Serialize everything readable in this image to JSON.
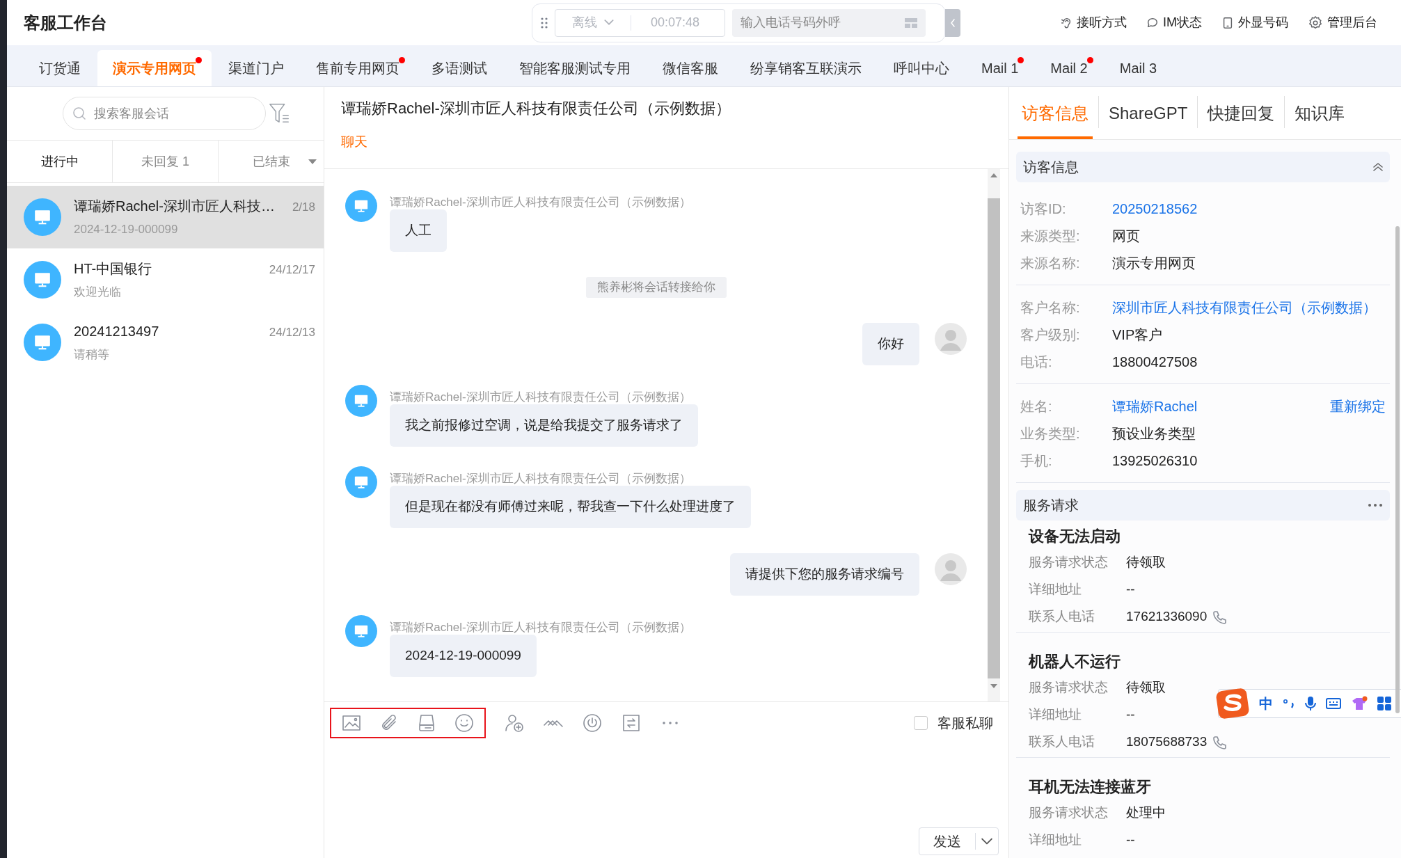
{
  "header": {
    "title": "客服工作台",
    "status": "离线",
    "timer": "00:07:48",
    "dial_placeholder": "输入电话号码外呼",
    "actions": [
      {
        "kind": "ear",
        "label": "接听方式"
      },
      {
        "kind": "chat",
        "label": "IM状态"
      },
      {
        "kind": "phone",
        "label": "外显号码"
      },
      {
        "kind": "gear",
        "label": "管理后台"
      }
    ]
  },
  "tabs": [
    {
      "label": "订货通",
      "selected": false,
      "dot": false
    },
    {
      "label": "演示专用网页",
      "selected": true,
      "dot": true
    },
    {
      "label": "渠道门户",
      "selected": false,
      "dot": false
    },
    {
      "label": "售前专用网页",
      "selected": false,
      "dot": true
    },
    {
      "label": "多语测试",
      "selected": false,
      "dot": false
    },
    {
      "label": "智能客服测试专用",
      "selected": false,
      "dot": false
    },
    {
      "label": "微信客服",
      "selected": false,
      "dot": false
    },
    {
      "label": "纷享销客互联演示",
      "selected": false,
      "dot": false
    },
    {
      "label": "呼叫中心",
      "selected": false,
      "dot": false
    },
    {
      "label": "Mail 1",
      "selected": false,
      "dot": true
    },
    {
      "label": "Mail 2",
      "selected": false,
      "dot": true
    },
    {
      "label": "Mail 3",
      "selected": false,
      "dot": false
    }
  ],
  "sidebar": {
    "search_placeholder": "搜索客服会话",
    "filters": [
      {
        "label": "进行中",
        "selected": true
      },
      {
        "label": "未回复 1",
        "selected": false
      },
      {
        "label": "已结束",
        "selected": false
      }
    ],
    "sessions": [
      {
        "name": "谭瑞娇Rachel-深圳市匠人科技…",
        "time": "2/18",
        "preview": "2024-12-19-000099",
        "selected": true
      },
      {
        "name": "HT-中国银行",
        "time": "24/12/17",
        "preview": "欢迎光临",
        "selected": false
      },
      {
        "name": "20241213497",
        "time": "24/12/13",
        "preview": "请稍等",
        "selected": false
      }
    ]
  },
  "chat": {
    "title": "谭瑞娇Rachel-深圳市匠人科技有限责任公司（示例数据）",
    "subtab": "聊天",
    "messages": [
      {
        "kind": "visitor",
        "sender": "谭瑞娇Rachel-深圳市匠人科技有限责任公司（示例数据）",
        "text": "人工"
      },
      {
        "kind": "system",
        "text": "熊养彬将会话转接给你"
      },
      {
        "kind": "agent",
        "text": "你好"
      },
      {
        "kind": "visitor",
        "sender": "谭瑞娇Rachel-深圳市匠人科技有限责任公司（示例数据）",
        "text": "我之前报修过空调，说是给我提交了服务请求了"
      },
      {
        "kind": "visitor",
        "sender": "谭瑞娇Rachel-深圳市匠人科技有限责任公司（示例数据）",
        "text": "但是现在都没有师傅过来呢，帮我查一下什么处理进度了"
      },
      {
        "kind": "agent",
        "text": "请提供下您的服务请求编号"
      },
      {
        "kind": "visitor",
        "sender": "谭瑞娇Rachel-深圳市匠人科技有限责任公司（示例数据）",
        "text": "2024-12-19-000099"
      }
    ],
    "private_chat": {
      "label": "客服私聊",
      "checked": false
    },
    "send": "发送"
  },
  "panel": {
    "tabs": [
      {
        "label": "访客信息",
        "selected": true
      },
      {
        "label": "ShareGPT",
        "selected": false
      },
      {
        "label": "快捷回复",
        "selected": false
      },
      {
        "label": "知识库",
        "selected": false
      }
    ],
    "visitor_title": "访客信息",
    "groups": [
      [
        {
          "label": "访客ID:",
          "value": "20250218562",
          "link": true
        },
        {
          "label": "来源类型:",
          "value": "网页",
          "link": false
        },
        {
          "label": "来源名称:",
          "value": "演示专用网页",
          "link": false
        }
      ],
      [
        {
          "label": "客户名称:",
          "value": "深圳市匠人科技有限责任公司（示例数据）",
          "link": true
        },
        {
          "label": "客户级别:",
          "value": "VIP客户",
          "link": false
        },
        {
          "label": "电话:",
          "value": "18800427508",
          "link": false
        }
      ],
      [
        {
          "label": "姓名:",
          "value": "谭瑞娇Rachel",
          "link": true,
          "action": "重新绑定"
        },
        {
          "label": "业务类型:",
          "value": "预设业务类型",
          "link": false
        },
        {
          "label": "手机:",
          "value": "13925026310",
          "link": false
        }
      ]
    ],
    "service_title": "服务请求",
    "requests": [
      {
        "title": "设备无法启动",
        "fields": [
          {
            "label": "服务请求状态",
            "value": "待领取",
            "phone": false
          },
          {
            "label": "详细地址",
            "value": "--",
            "phone": false
          },
          {
            "label": "联系人电话",
            "value": "17621336090",
            "phone": true
          }
        ]
      },
      {
        "title": "机器人不运行",
        "fields": [
          {
            "label": "服务请求状态",
            "value": "待领取",
            "phone": false
          },
          {
            "label": "详细地址",
            "value": "--",
            "phone": false
          },
          {
            "label": "联系人电话",
            "value": "18075688733",
            "phone": true
          }
        ]
      },
      {
        "title": "耳机无法连接蓝牙",
        "fields": [
          {
            "label": "服务请求状态",
            "value": "处理中",
            "phone": false
          },
          {
            "label": "详细地址",
            "value": "--",
            "phone": false
          }
        ]
      }
    ]
  },
  "ime": {
    "mode": "中"
  }
}
